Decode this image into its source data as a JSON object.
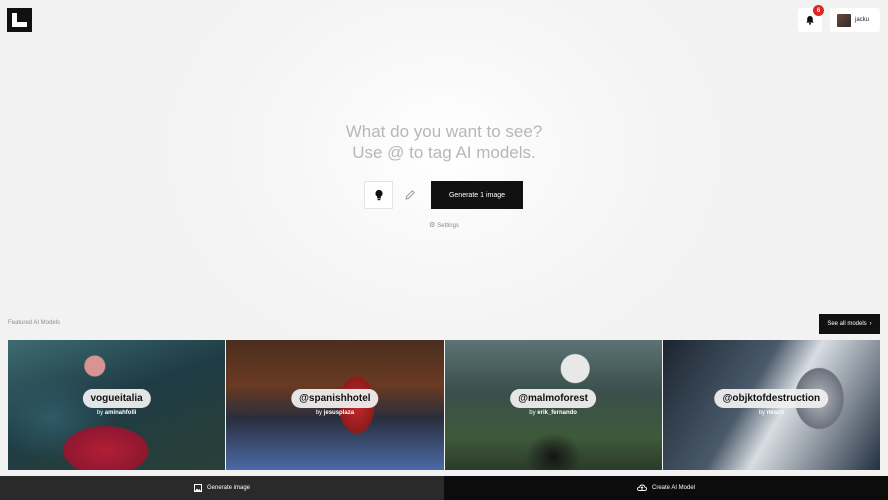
{
  "header": {
    "logo_icon": "logo-mark-icon",
    "notifications": {
      "icon": "bell-icon",
      "count": "6"
    },
    "user": {
      "name": "jacku",
      "avatar": "avatar"
    }
  },
  "prompt": {
    "line1": "What do you want to see?",
    "line2": "Use @ to tag AI models."
  },
  "toolbar": {
    "idea_icon": "lightbulb-icon",
    "edit_icon": "pencil-icon",
    "generate_label": "Generate 1 image"
  },
  "settings_label": "Settings",
  "featured": {
    "label": "Featured AI Models",
    "see_all": "See all models",
    "cards": [
      {
        "tag": "vogueitalia",
        "by": "by",
        "author": "aminahfolli"
      },
      {
        "tag": "@spanishhotel",
        "by": "by",
        "author": "jesusplaza"
      },
      {
        "tag": "@malmoforest",
        "by": "by",
        "author": "erik_fernando"
      },
      {
        "tag": "@objktofdestruction",
        "by": "by",
        "author": "misch"
      }
    ]
  },
  "bottom_bar": {
    "generate": "Generate image",
    "create": "Create AI Model"
  },
  "colors": {
    "accent": "#111111",
    "badge": "#e02424",
    "background": "#f2f2f2"
  }
}
